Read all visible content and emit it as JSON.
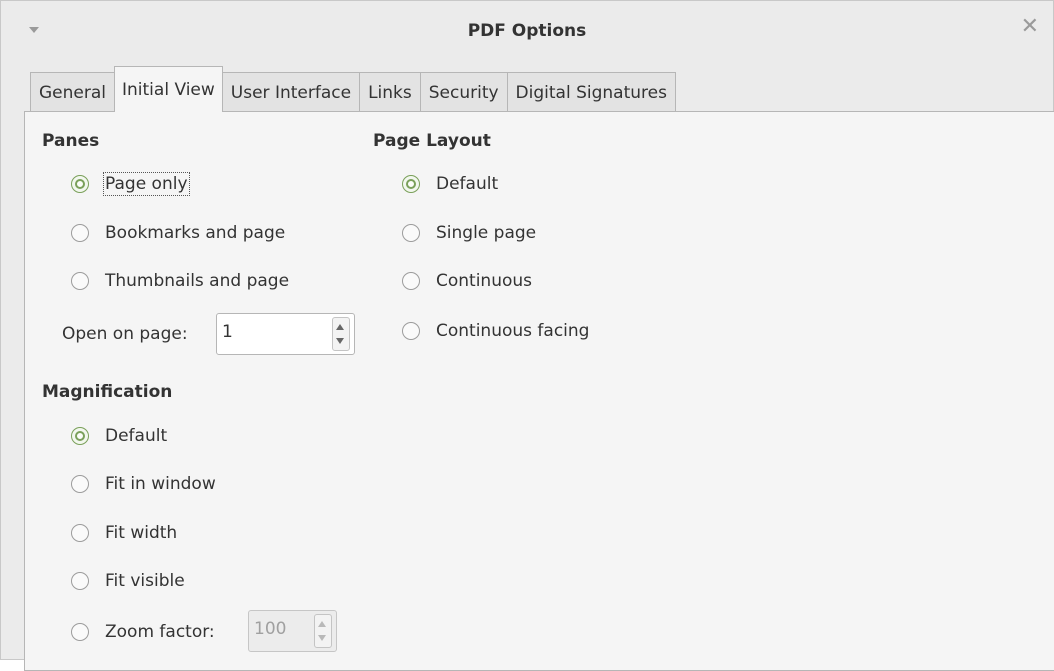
{
  "window": {
    "title": "PDF Options"
  },
  "tabs": [
    {
      "label": "General"
    },
    {
      "label": "Initial View"
    },
    {
      "label": "User Interface"
    },
    {
      "label": "Links"
    },
    {
      "label": "Security"
    },
    {
      "label": "Digital Signatures"
    }
  ],
  "active_tab": "Initial View",
  "panes": {
    "heading": "Panes",
    "options": [
      {
        "label": "Page only",
        "checked": true
      },
      {
        "label": "Bookmarks and page",
        "checked": false
      },
      {
        "label": "Thumbnails and page",
        "checked": false
      }
    ],
    "open_on_page_label": "Open on page:",
    "open_on_page_value": "1"
  },
  "page_layout": {
    "heading": "Page Layout",
    "options": [
      {
        "label": "Default",
        "checked": true
      },
      {
        "label": "Single page",
        "checked": false
      },
      {
        "label": "Continuous",
        "checked": false
      },
      {
        "label": "Continuous facing",
        "checked": false
      }
    ]
  },
  "magnification": {
    "heading": "Magnification",
    "options": [
      {
        "label": "Default",
        "checked": true
      },
      {
        "label": "Fit in window",
        "checked": false
      },
      {
        "label": "Fit width",
        "checked": false
      },
      {
        "label": "Fit visible",
        "checked": false
      },
      {
        "label": "Zoom factor:",
        "checked": false
      }
    ],
    "zoom_value": "100"
  },
  "colors": {
    "accent": "#7aa05a",
    "panel": "#f5f5f5",
    "chrome": "#ebebeb"
  },
  "icons": {
    "window_menu": "chevron-down-icon",
    "close": "close-icon"
  }
}
